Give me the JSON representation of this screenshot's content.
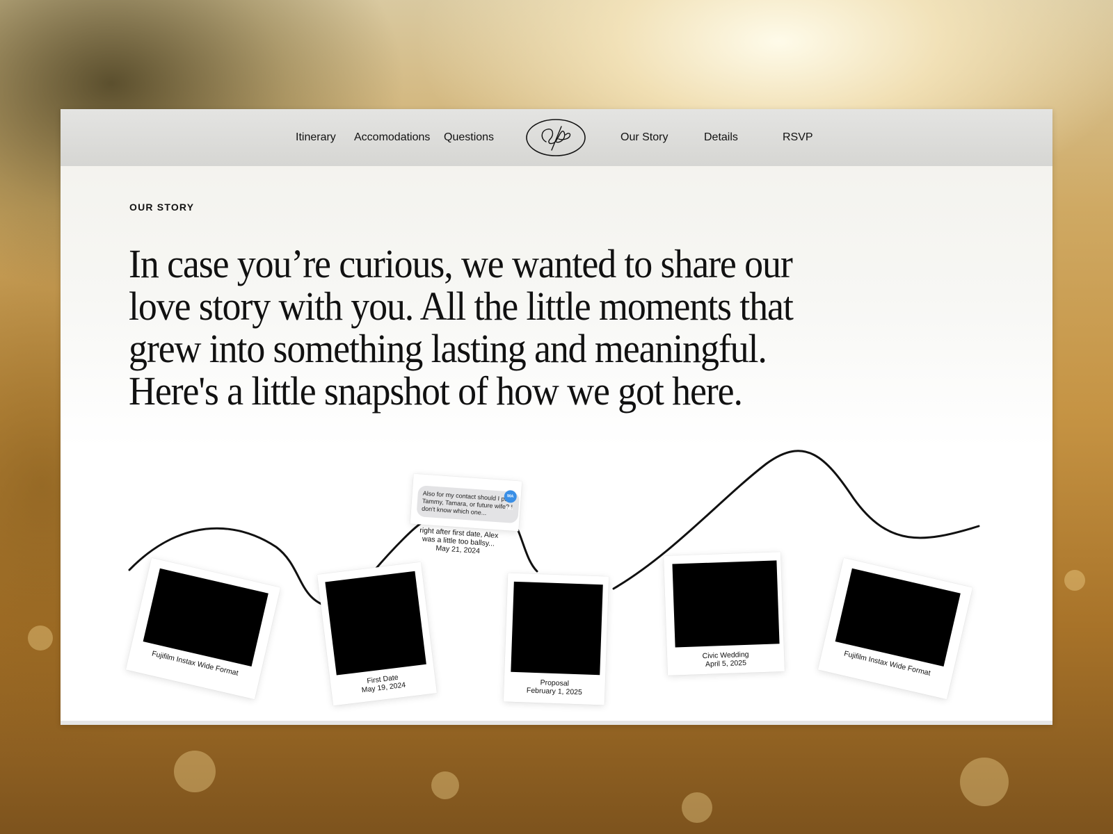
{
  "nav": {
    "left_links": [
      "Itinerary",
      "Accomodations",
      "Questions"
    ],
    "right_links": [
      "Our Story",
      "Details",
      "RSVP"
    ],
    "logo_icon": "monogram-logo-icon"
  },
  "section": {
    "eyebrow": "OUR STORY",
    "headline": "In case you’re curious, we wanted to share our love story with you. All the little moments that grew into something lasting and meaningful. Here's a little snapshot of how we got here."
  },
  "timeline": {
    "polaroids": [
      {
        "caption_line1": "Fujifilm Instax Wide Format",
        "caption_line2": ""
      },
      {
        "caption_line1": "First Date",
        "caption_line2": "May 19, 2024"
      },
      {
        "caption_line1": "Proposal",
        "caption_line2": "February 1, 2025"
      },
      {
        "caption_line1": "Civic Wedding",
        "caption_line2": "April 5, 2025"
      },
      {
        "caption_line1": "Fujifilm Instax Wide Format",
        "caption_line2": ""
      }
    ],
    "message": {
      "text": "Also for my contact should I put Tammy, Tamara, or future wife? I don't know which one...",
      "avatar_initials": "MA MA"
    },
    "note": {
      "line1": "right after first date, Alex",
      "line2": "was a little too ballsy...",
      "line3": "May 21, 2024"
    }
  },
  "colors": {
    "nav_bg": "#d9d9d6",
    "text": "#111111",
    "photo": "#000000",
    "avatar": "#3a8fe6"
  }
}
